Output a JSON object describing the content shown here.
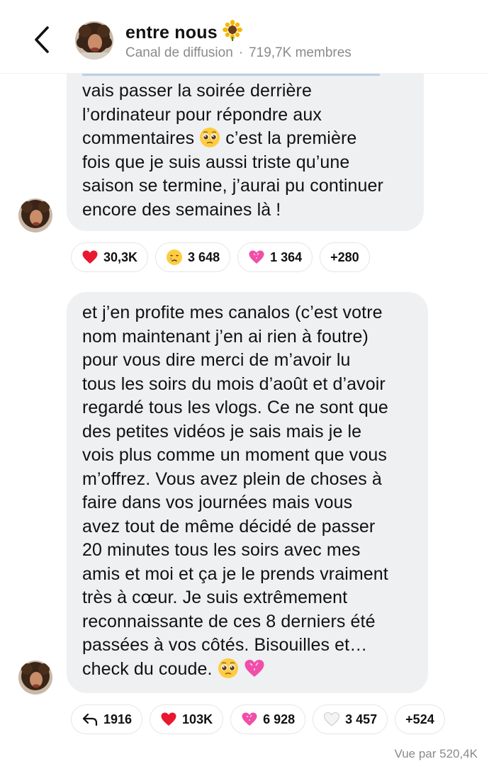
{
  "header": {
    "title": "entre nous",
    "channel_type": "Canal de diffusion",
    "separator": "·",
    "member_count": "719,7K membres"
  },
  "messages": [
    {
      "text_lines": "vais passer la soirée derrière\nl’ordinateur pour répondre aux\ncommentaires ",
      "text_after_emoji": " c’est la première\nfois que je suis aussi triste qu’une\nsaison se termine, j’aurai pu continuer\nencore des semaines là !",
      "reactions": [
        {
          "emoji": "red-heart",
          "count": "30,3K"
        },
        {
          "emoji": "crying-face",
          "count": "3 648"
        },
        {
          "emoji": "pink-heart",
          "count": "1 364"
        },
        {
          "emoji": "",
          "count": "+280"
        }
      ]
    },
    {
      "text": "et j’en profite mes canalos (c’est votre\nnom maintenant j’en ai rien à foutre)\npour vous dire merci de m’avoir lu\ntous les soirs du mois d’août et d’avoir\nregardé tous les vlogs. Ce ne sont que\ndes petites vidéos je sais mais je le\nvois plus comme un moment que vous\nm’offrez. Vous avez plein de choses à\nfaire dans vos journées mais vous\navez tout de même décidé de passer\n20 minutes tous les soirs avec mes\namis et moi et ça je le prends vraiment\ntrès à cœur. Je suis extrêmement\nreconnaissante de ces 8 derniers été\npassées à vos côtés. Bisouilles et…\ncheck du coude. ",
      "reactions": [
        {
          "emoji": "reply-arrow",
          "count": "1916"
        },
        {
          "emoji": "red-heart",
          "count": "103K"
        },
        {
          "emoji": "pink-heart",
          "count": "6 928"
        },
        {
          "emoji": "white-heart",
          "count": "3 457"
        },
        {
          "emoji": "",
          "count": "+524"
        }
      ]
    }
  ],
  "seen_by": "Vue par 520,4K",
  "colors": {
    "bubble": "#eff0f2",
    "muted": "#8a8a8e"
  }
}
